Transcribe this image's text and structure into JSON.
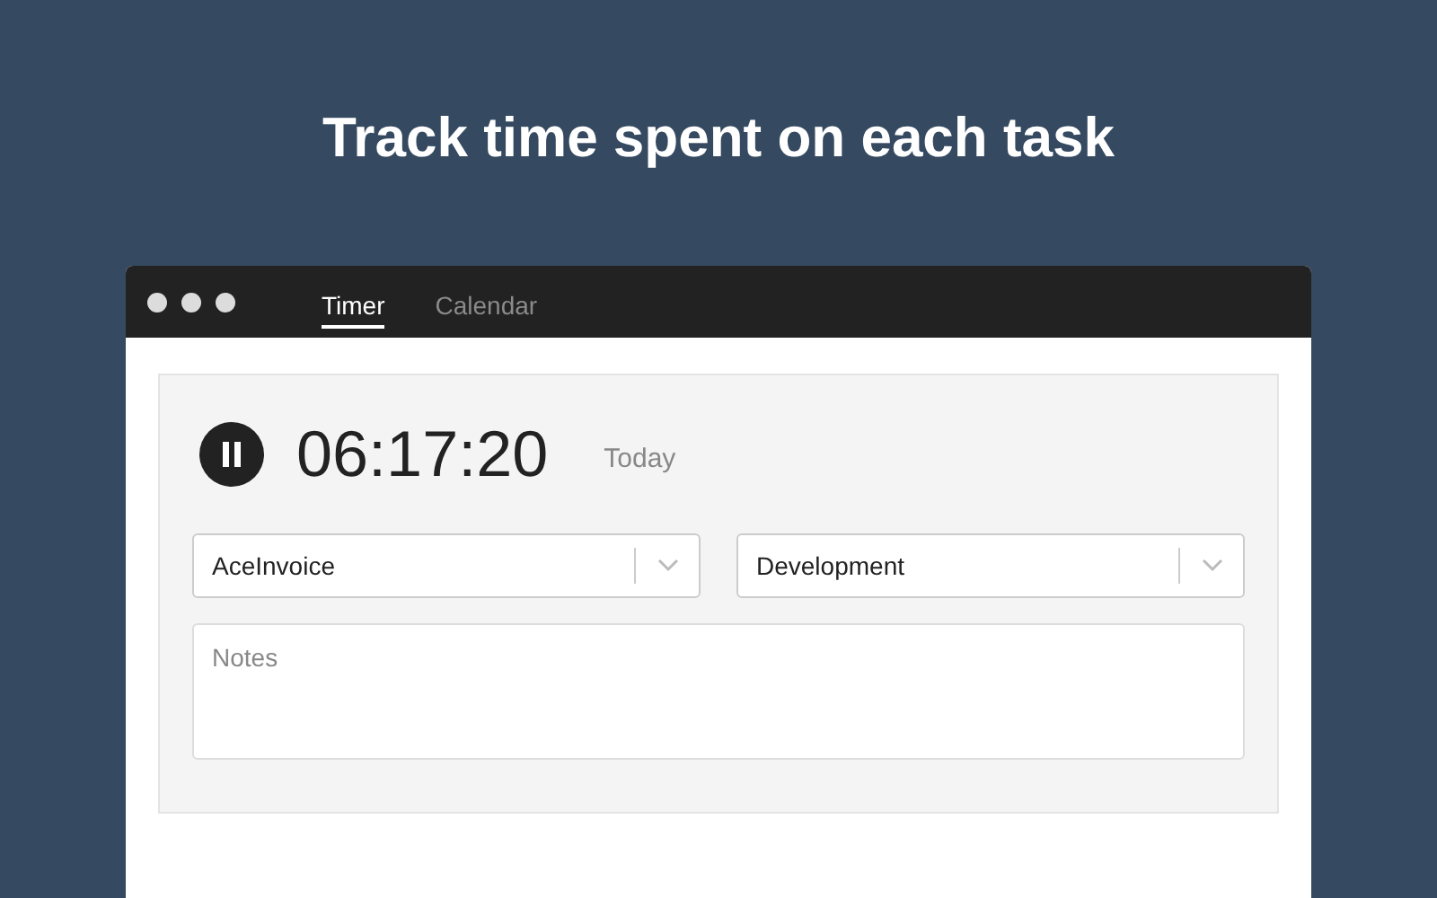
{
  "headline": "Track time spent on each task",
  "tabs": [
    {
      "label": "Timer",
      "selected": true
    },
    {
      "label": "Calendar",
      "selected": false
    }
  ],
  "timer": {
    "running": true,
    "time": "06:17:20",
    "day": "Today"
  },
  "selects": [
    {
      "value": "AceInvoice"
    },
    {
      "value": "Development"
    }
  ],
  "notes": {
    "placeholder": "Notes"
  }
}
